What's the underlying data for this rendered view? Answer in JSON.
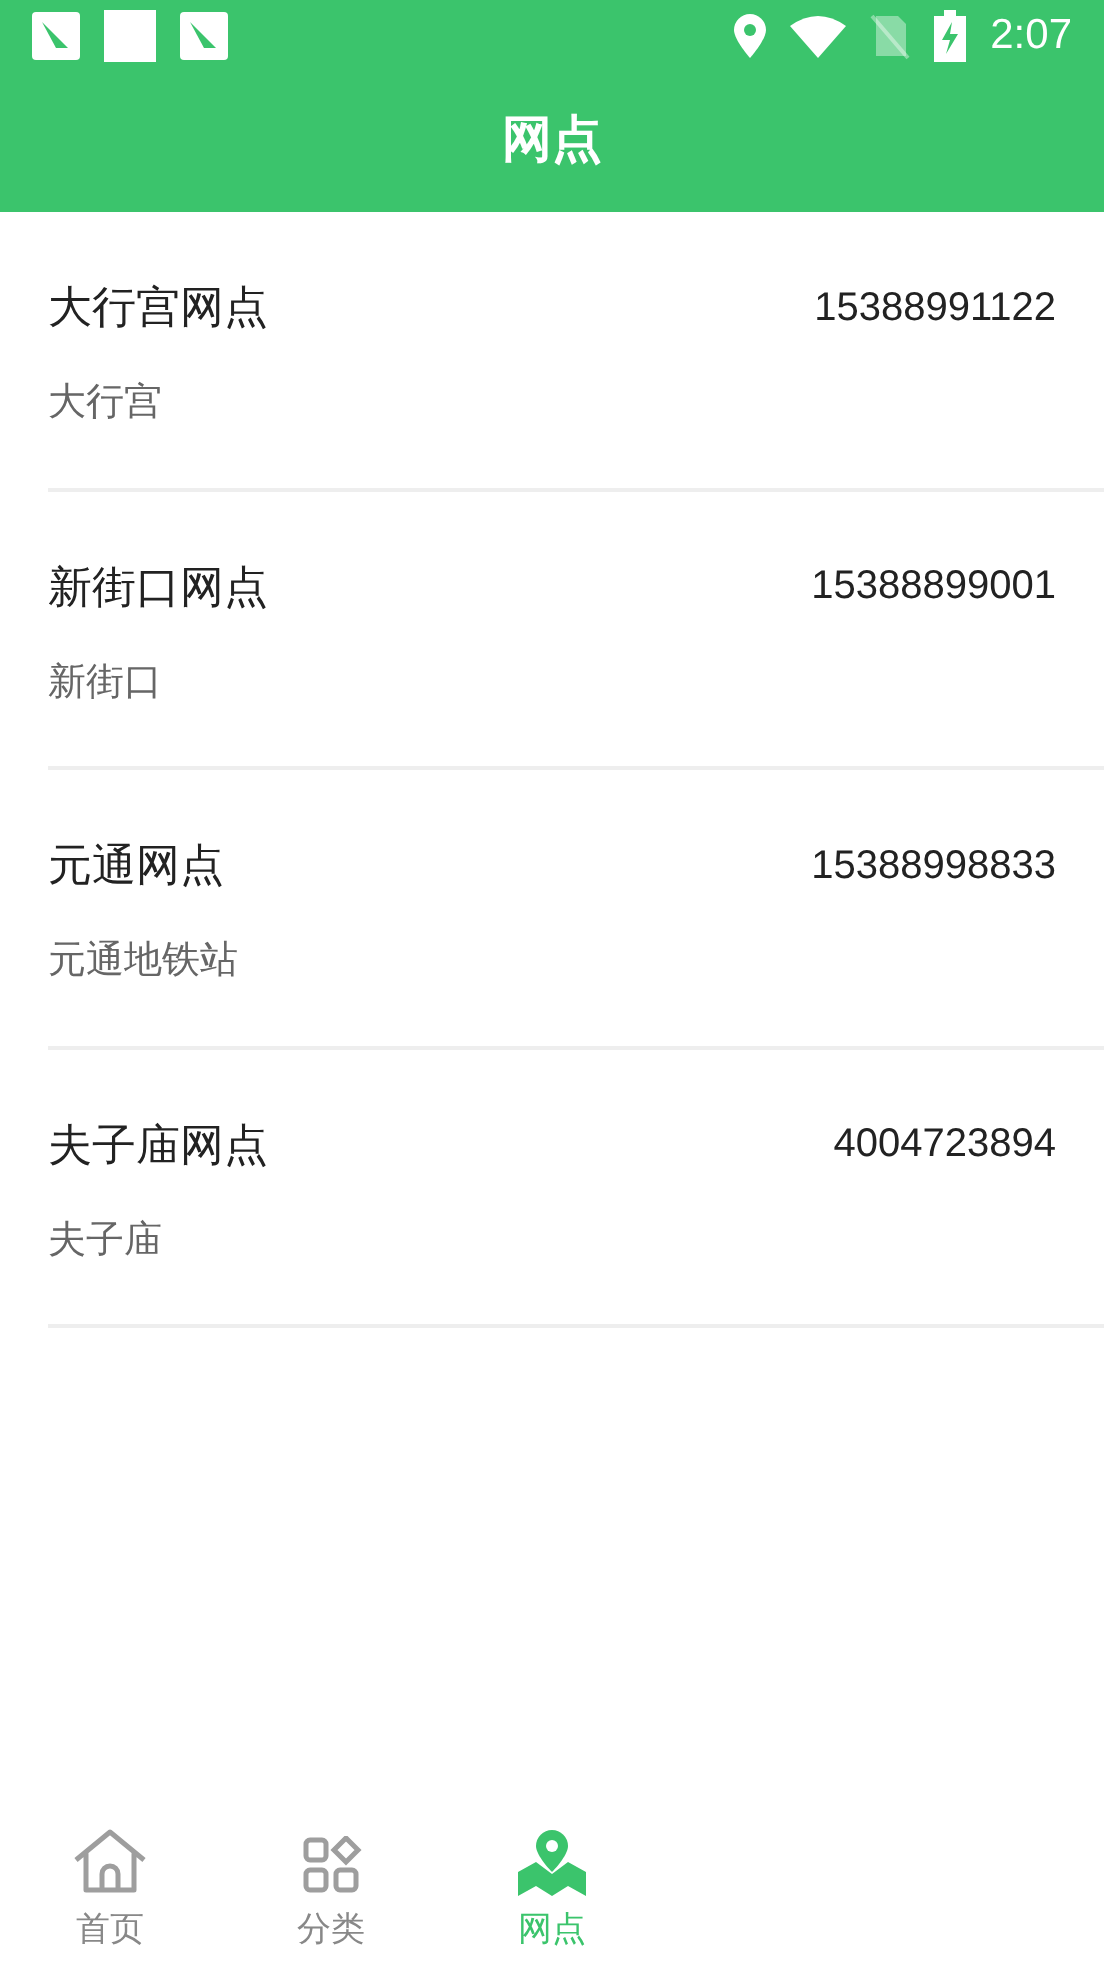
{
  "status_bar": {
    "time": "2:07"
  },
  "header": {
    "title": "网点"
  },
  "outlets": [
    {
      "name": "大行宫网点",
      "phone": "15388991122",
      "address": "大行宫"
    },
    {
      "name": "新街口网点",
      "phone": "15388899001",
      "address": "新街口"
    },
    {
      "name": "元通网点",
      "phone": "15388998833",
      "address": "元通地铁站"
    },
    {
      "name": "夫子庙网点",
      "phone": "4004723894",
      "address": "夫子庙"
    }
  ],
  "tab_bar": [
    {
      "kind": "home",
      "label": "首页",
      "selected": false
    },
    {
      "kind": "category",
      "label": "分类",
      "selected": false
    },
    {
      "kind": "outlet",
      "label": "网点",
      "selected": true
    }
  ]
}
